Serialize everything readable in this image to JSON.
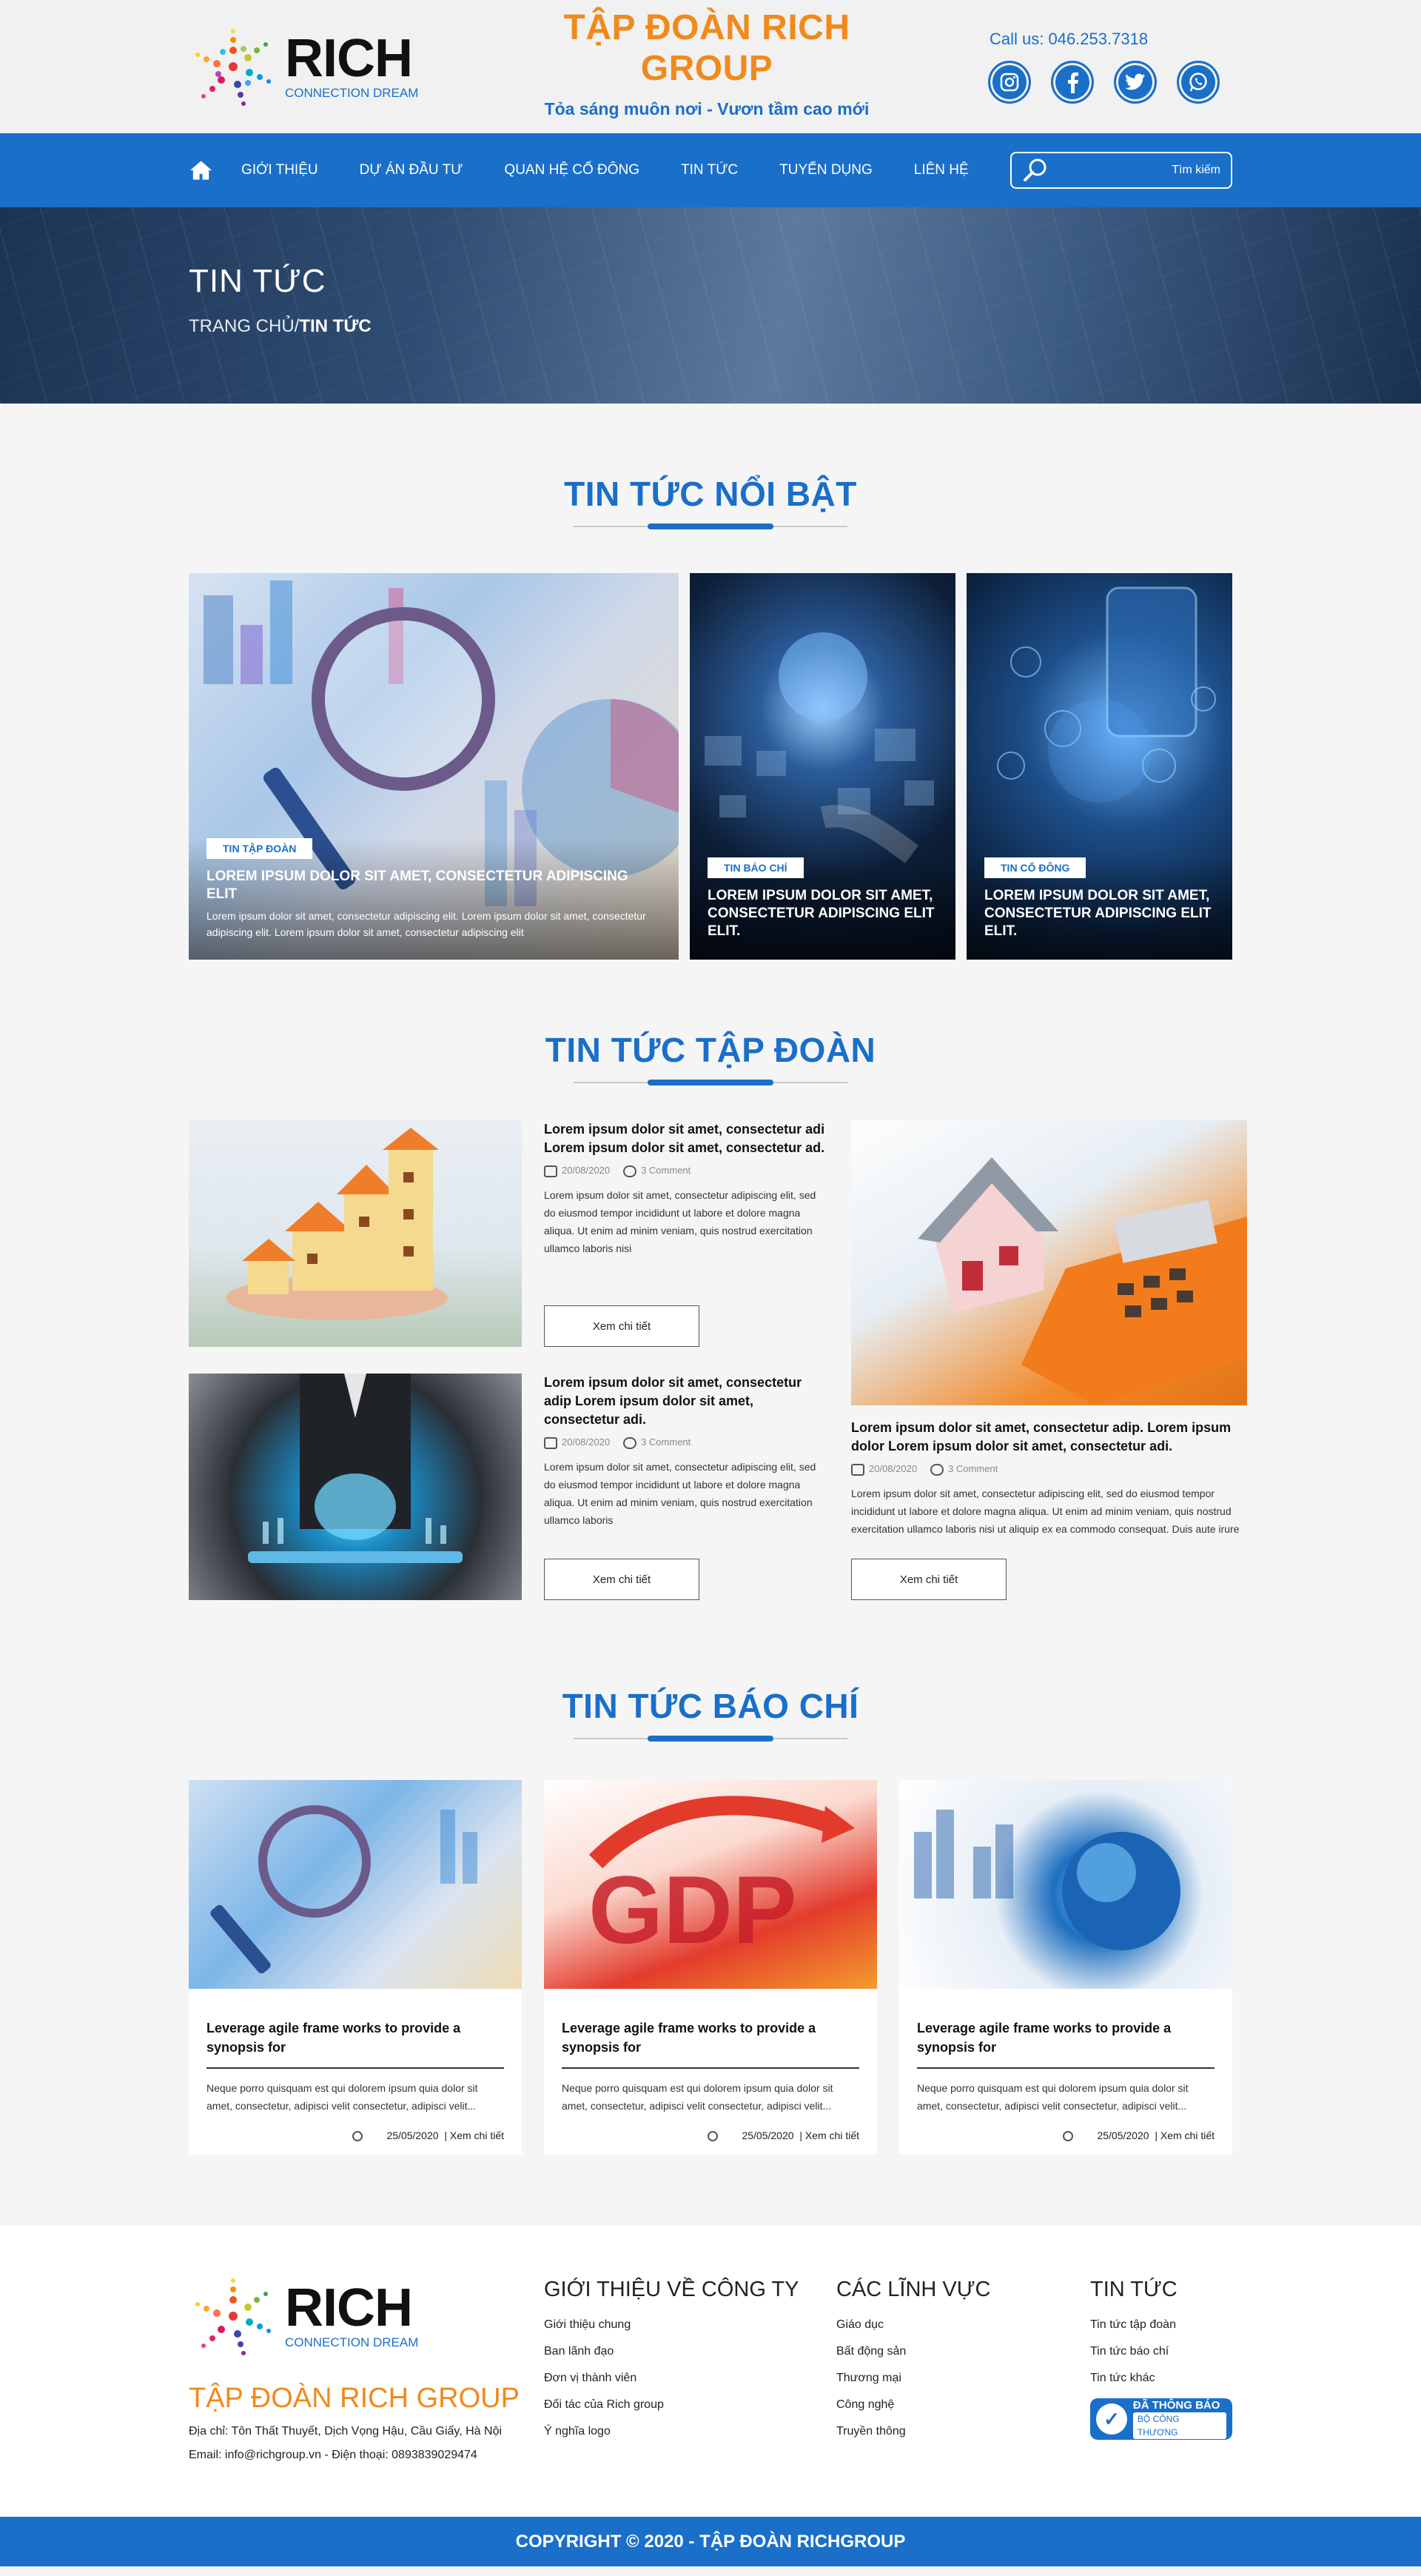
{
  "header": {
    "logo_main": "RICH",
    "logo_sub": "CONNECTION DREAM",
    "brand_title": "TẬP ĐOÀN RICH GROUP",
    "slogan": "Tỏa sáng muôn nơi - Vươn tầm cao mới",
    "call": "Call us: 046.253.7318",
    "socials": [
      "instagram-icon",
      "facebook-icon",
      "twitter-icon",
      "whatsapp-icon"
    ]
  },
  "nav": {
    "items": [
      "GIỚI THIỆU",
      "DỰ ÁN ĐẦU TƯ",
      "QUAN HỆ CỔ ĐÔNG",
      "TIN TỨC",
      "TUYỂN DỤNG",
      "LIÊN HỆ"
    ],
    "search_placeholder": "Tìm kiếm"
  },
  "banner": {
    "title": "TIN TỨC",
    "crumb_home": "TRANG CHỦ/",
    "crumb_current": "TIN TỨC"
  },
  "featured": {
    "title": "TIN TỨC NỔI BẬT",
    "items": [
      {
        "tag": "TIN TẬP ĐOÀN",
        "title": "LOREM IPSUM DOLOR SIT AMET, CONSECTETUR ADIPISCING ELIT",
        "desc": "Lorem ipsum dolor sit amet, consectetur adipiscing elit. Lorem ipsum dolor sit amet, consectetur adipiscing elit. Lorem ipsum dolor sit amet, consectetur adipiscing elit"
      },
      {
        "tag": "TIN BÁO CHÍ",
        "title": "LOREM IPSUM DOLOR SIT AMET, CONSECTETUR ADIPISCING ELIT ELIT."
      },
      {
        "tag": "TIN CỔ ĐÔNG",
        "title": "LOREM IPSUM DOLOR SIT AMET, CONSECTETUR ADIPISCING ELIT ELIT."
      }
    ]
  },
  "group": {
    "title": "TIN TỨC TẬP ĐOÀN",
    "items": [
      {
        "title": "Lorem ipsum dolor sit amet, consectetur adi Lorem ipsum dolor sit amet, consectetur ad.",
        "date": "20/08/2020",
        "comments": "3 Comment",
        "desc": "Lorem ipsum dolor sit amet, consectetur adipiscing elit, sed do eiusmod tempor incididunt ut labore et dolore magna aliqua. Ut enim ad minim veniam, quis nostrud exercitation ullamco laboris nisi",
        "button": "Xem chi tiết"
      },
      {
        "title": "Lorem ipsum dolor sit amet, consectetur adip Lorem ipsum dolor sit amet, consectetur adi.",
        "date": "20/08/2020",
        "comments": "3 Comment",
        "desc": "Lorem ipsum dolor sit amet, consectetur adipiscing elit, sed do eiusmod tempor incididunt ut labore et dolore magna aliqua. Ut enim ad minim veniam, quis nostrud exercitation ullamco laboris",
        "button": "Xem chi tiết"
      },
      {
        "title": "Lorem ipsum dolor sit amet, consectetur adip. Lorem ipsum dolor Lorem ipsum dolor sit amet, consectetur adi.",
        "date": "20/08/2020",
        "comments": "3 Comment",
        "desc": "Lorem ipsum dolor sit amet, consectetur adipiscing elit, sed do eiusmod tempor incididunt ut labore et dolore magna aliqua. Ut enim ad minim veniam, quis nostrud exercitation ullamco laboris nisi ut aliquip ex ea commodo consequat. Duis aute irure",
        "button": "Xem chi tiết"
      }
    ]
  },
  "press": {
    "title": "TIN TỨC BÁO CHÍ",
    "items": [
      {
        "title": "Leverage agile frame works to provide a synopsis for",
        "desc": "Neque porro quisquam est qui dolorem ipsum quia dolor sit amet, consectetur, adipisci velit consectetur, adipisci velit...",
        "date": "25/05/2020",
        "link": "| Xem chi tiết"
      },
      {
        "title": "Leverage agile frame works to provide a synopsis for",
        "desc": "Neque porro quisquam est qui dolorem ipsum quia dolor sit amet, consectetur, adipisci velit consectetur, adipisci velit...",
        "date": "25/05/2020",
        "link": "| Xem chi tiết"
      },
      {
        "title": "Leverage agile frame works to provide a synopsis for",
        "desc": "Neque porro quisquam est qui dolorem ipsum quia dolor sit amet, consectetur, adipisci velit consectetur, adipisci velit...",
        "date": "25/05/2020",
        "link": "| Xem chi tiết"
      }
    ]
  },
  "footer": {
    "logo_main": "RICH",
    "logo_sub": "CONNECTION DREAM",
    "brand": "TẬP ĐOÀN RICH GROUP",
    "address": "Địa chỉ: Tôn Thất Thuyết, Dịch Vọng Hậu, Cầu Giấy, Hà Nội",
    "contact": "Email: info@richgroup.vn - Điện thoại: 0893839029474",
    "col1": {
      "title": "GIỚI THIỆU VỀ CÔNG TY",
      "links": [
        "Giới thiệu chung",
        "Ban lãnh đạo",
        "Đơn vị thành viên",
        "Đối tác của Rich group",
        "Ý nghĩa logo"
      ]
    },
    "col2": {
      "title": "CÁC LĨNH VỰC",
      "links": [
        "Giáo dục",
        "Bất động sản",
        "Thương mại",
        "Công nghệ",
        "Truyền thông"
      ]
    },
    "col3": {
      "title": "TIN TỨC",
      "links": [
        "Tin tức tập đoàn",
        "Tin tức báo chí",
        "Tin tức khác"
      ]
    },
    "badge_title": "ĐÃ THÔNG BÁO",
    "badge_sub": "BỘ CÔNG THƯƠNG"
  },
  "copyright": "COPYRIGHT © 2020 - TẬP ĐOÀN RICHGROUP",
  "colors": {
    "primary": "#1a6fc9",
    "accent": "#f08a1c"
  }
}
